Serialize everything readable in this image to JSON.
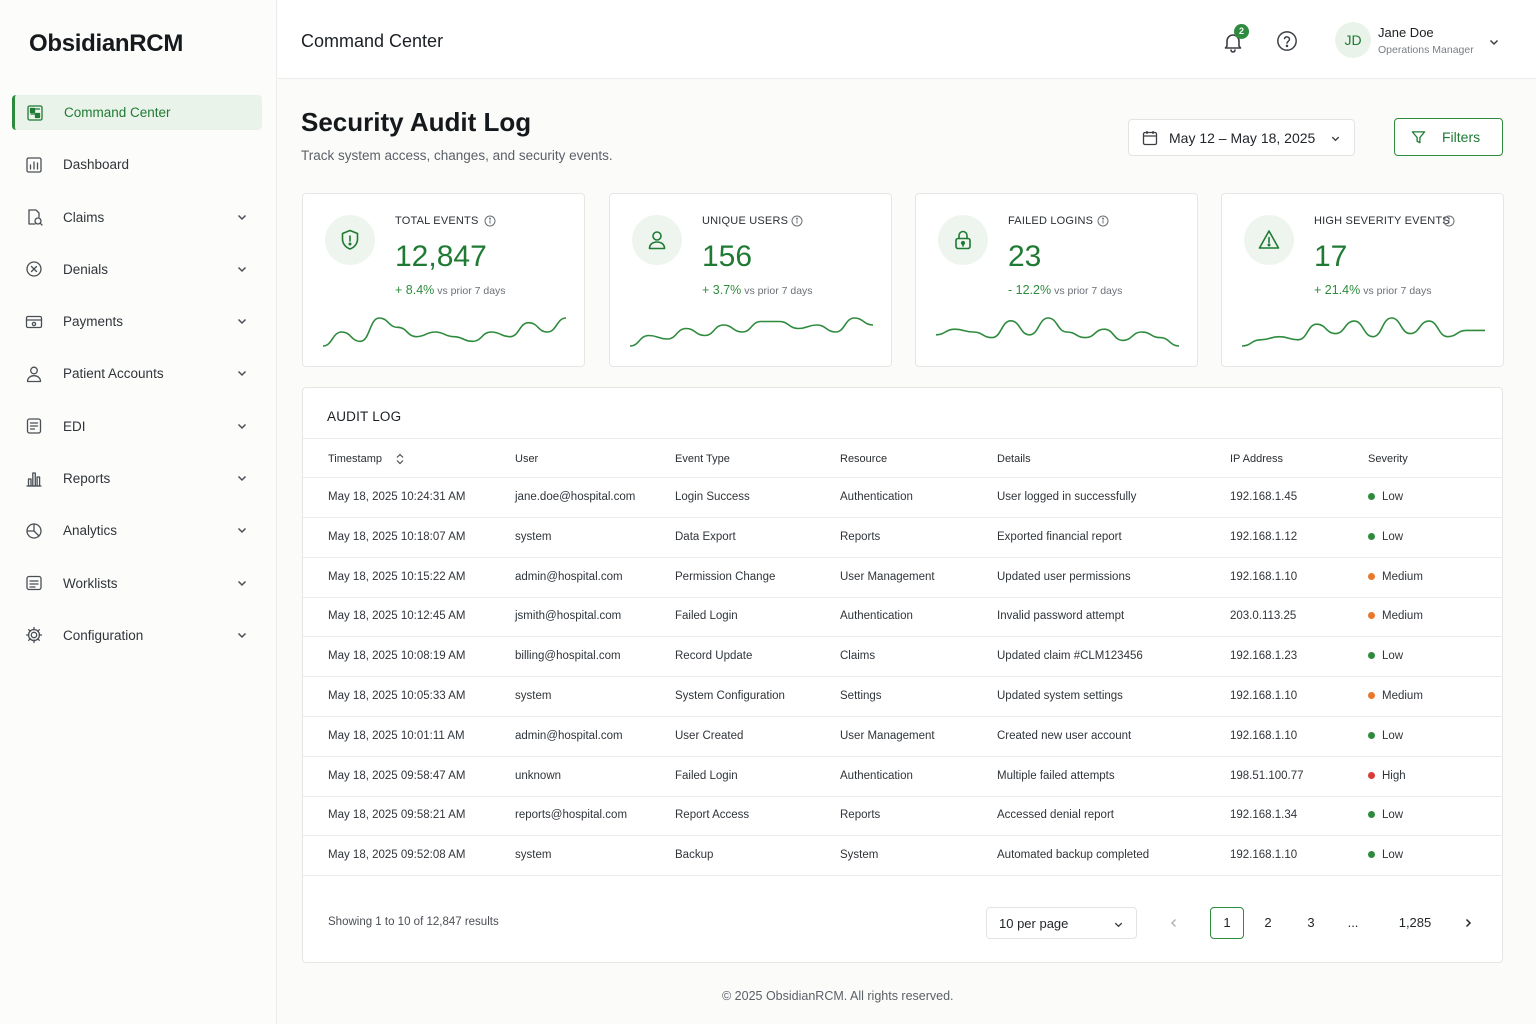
{
  "brand": "ObsidianRCM",
  "sidebar": {
    "items": [
      {
        "label": "Command Center",
        "icon": "command-center-icon",
        "active": true,
        "expandable": false
      },
      {
        "label": "Dashboard",
        "icon": "dashboard-icon",
        "active": false,
        "expandable": false
      },
      {
        "label": "Claims",
        "icon": "claims-icon",
        "active": false,
        "expandable": true
      },
      {
        "label": "Denials",
        "icon": "denials-icon",
        "active": false,
        "expandable": true
      },
      {
        "label": "Payments",
        "icon": "payments-icon",
        "active": false,
        "expandable": true
      },
      {
        "label": "Patient Accounts",
        "icon": "patient-icon",
        "active": false,
        "expandable": true
      },
      {
        "label": "EDI",
        "icon": "edi-icon",
        "active": false,
        "expandable": true
      },
      {
        "label": "Reports",
        "icon": "reports-icon",
        "active": false,
        "expandable": true
      },
      {
        "label": "Analytics",
        "icon": "analytics-icon",
        "active": false,
        "expandable": true
      },
      {
        "label": "Worklists",
        "icon": "worklists-icon",
        "active": false,
        "expandable": true
      },
      {
        "label": "Configuration",
        "icon": "gear-icon",
        "active": false,
        "expandable": true
      }
    ]
  },
  "topbar": {
    "title": "Command Center",
    "notification_count": "2",
    "user": {
      "initials": "JD",
      "name": "Jane Doe",
      "role": "Operations Manager"
    }
  },
  "page": {
    "title": "Security Audit Log",
    "subtitle": "Track system access, changes, and security events.",
    "date_range": "May 12 – May 18, 2025",
    "filters_label": "Filters"
  },
  "stats": [
    {
      "label": "TOTAL EVENTS",
      "value": "12,847",
      "change": "+ 8.4%",
      "vs": "vs prior 7 days",
      "icon": "shield-icon",
      "trend": [
        3,
        6,
        4,
        9,
        7,
        5,
        6,
        5,
        4,
        6,
        5,
        8,
        6,
        9
      ]
    },
    {
      "label": "UNIQUE USERS",
      "value": "156",
      "change": "+ 3.7%",
      "vs": "vs prior 7 days",
      "icon": "user-icon",
      "trend": [
        3,
        6,
        5,
        8,
        6,
        9,
        7,
        10,
        10,
        8,
        9,
        7,
        11,
        9
      ]
    },
    {
      "label": "FAILED LOGINS",
      "value": "23",
      "change": "- 12.2%",
      "vs": "vs prior 7 days",
      "icon": "lock-icon",
      "trend": [
        8,
        10,
        9,
        7,
        13,
        8,
        14,
        9,
        7,
        10,
        6,
        9,
        7,
        4
      ]
    },
    {
      "label": "HIGH SEVERITY EVENTS",
      "value": "17",
      "change": "+ 21.4%",
      "vs": "vs prior 7 days",
      "icon": "warning-icon",
      "trend": [
        3,
        5,
        6,
        5,
        10,
        7,
        11,
        6,
        12,
        7,
        11,
        6,
        8,
        8
      ]
    }
  ],
  "audit": {
    "title": "AUDIT LOG",
    "columns": [
      "Timestamp",
      "User",
      "Event Type",
      "Resource",
      "Details",
      "IP Address",
      "Severity"
    ],
    "rows": [
      {
        "timestamp": "May 18, 2025 10:24:31 AM",
        "user": "jane.doe@hospital.com",
        "event": "Login Success",
        "resource": "Authentication",
        "details": "User logged in successfully",
        "ip": "192.168.1.45",
        "severity": "Low"
      },
      {
        "timestamp": "May 18, 2025 10:18:07 AM",
        "user": "system",
        "event": "Data Export",
        "resource": "Reports",
        "details": "Exported financial report",
        "ip": "192.168.1.12",
        "severity": "Low"
      },
      {
        "timestamp": "May 18, 2025 10:15:22 AM",
        "user": "admin@hospital.com",
        "event": "Permission Change",
        "resource": "User Management",
        "details": "Updated user permissions",
        "ip": "192.168.1.10",
        "severity": "Medium"
      },
      {
        "timestamp": "May 18, 2025 10:12:45 AM",
        "user": "jsmith@hospital.com",
        "event": "Failed Login",
        "resource": "Authentication",
        "details": "Invalid password attempt",
        "ip": "203.0.113.25",
        "severity": "Medium"
      },
      {
        "timestamp": "May 18, 2025 10:08:19 AM",
        "user": "billing@hospital.com",
        "event": "Record Update",
        "resource": "Claims",
        "details": "Updated claim #CLM123456",
        "ip": "192.168.1.23",
        "severity": "Low"
      },
      {
        "timestamp": "May 18, 2025 10:05:33 AM",
        "user": "system",
        "event": "System Configuration",
        "resource": "Settings",
        "details": "Updated system settings",
        "ip": "192.168.1.10",
        "severity": "Medium"
      },
      {
        "timestamp": "May 18, 2025 10:01:11 AM",
        "user": "admin@hospital.com",
        "event": "User Created",
        "resource": "User Management",
        "details": "Created new user account",
        "ip": "192.168.1.10",
        "severity": "Low"
      },
      {
        "timestamp": "May 18, 2025 09:58:47 AM",
        "user": "unknown",
        "event": "Failed Login",
        "resource": "Authentication",
        "details": "Multiple failed attempts",
        "ip": "198.51.100.77",
        "severity": "High"
      },
      {
        "timestamp": "May 18, 2025 09:58:21 AM",
        "user": "reports@hospital.com",
        "event": "Report Access",
        "resource": "Reports",
        "details": "Accessed denial report",
        "ip": "192.168.1.34",
        "severity": "Low"
      },
      {
        "timestamp": "May 18, 2025 09:52:08 AM",
        "user": "system",
        "event": "Backup",
        "resource": "System",
        "details": "Automated backup completed",
        "ip": "192.168.1.10",
        "severity": "Low"
      }
    ],
    "severity_colors": {
      "Low": "#2e8b3e",
      "Medium": "#e8782b",
      "High": "#d93a3a"
    },
    "showing": "Showing 1 to 10 of 12,847 results",
    "per_page": "10 per page",
    "pages": [
      "1",
      "2",
      "3",
      "...",
      "1,285"
    ],
    "current_page": "1"
  },
  "footer": "© 2025 ObsidianRCM. All rights reserved.",
  "colors": {
    "accent": "#2e8b3e",
    "accent_dark": "#1f7a34",
    "accent_bg": "#eaf3ea"
  }
}
